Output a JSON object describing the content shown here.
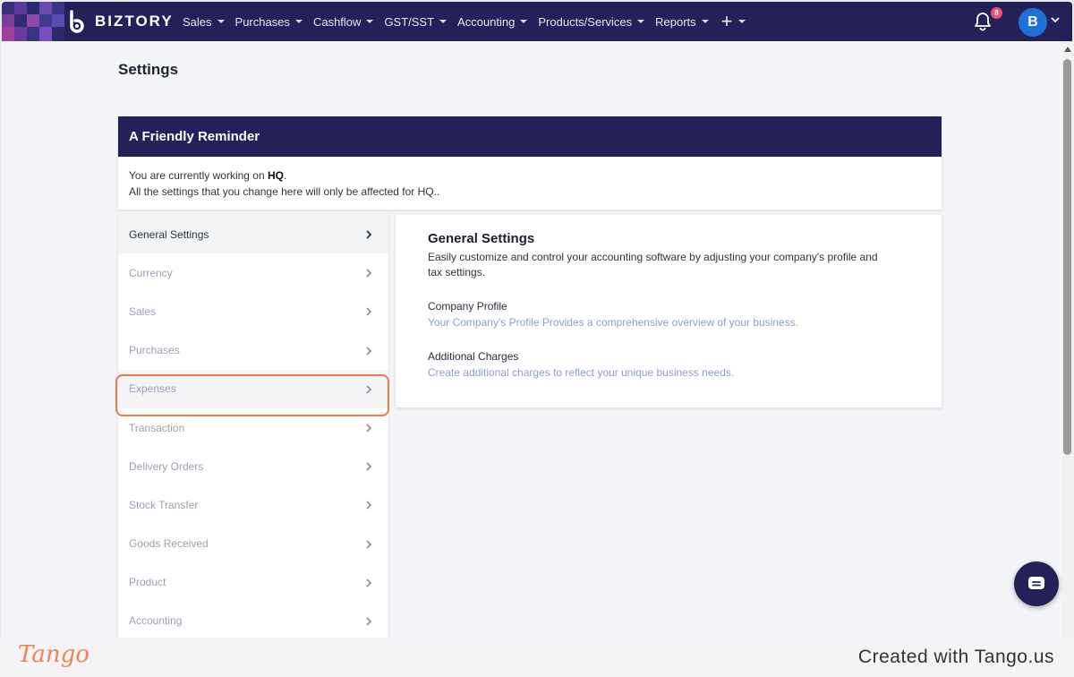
{
  "app": {
    "name": "BIZTORY"
  },
  "nav": {
    "items": [
      {
        "label": "Sales"
      },
      {
        "label": "Purchases"
      },
      {
        "label": "Cashflow"
      },
      {
        "label": "GST/SST"
      },
      {
        "label": "Accounting"
      },
      {
        "label": "Products/Services"
      },
      {
        "label": "Reports"
      }
    ],
    "plus_icon": "plus-icon",
    "notification_count": "8",
    "avatar_initial": "B"
  },
  "page": {
    "title": "Settings"
  },
  "reminder": {
    "title": "A Friendly Reminder",
    "line1_prefix": "You are currently working on ",
    "branch": "HQ",
    "line1_suffix": ".",
    "line2": "All the settings that you change here will only be affected for HQ.."
  },
  "menu": {
    "items": [
      {
        "label": "General Settings"
      },
      {
        "label": "Currency"
      },
      {
        "label": "Sales"
      },
      {
        "label": "Purchases"
      },
      {
        "label": "Expenses"
      },
      {
        "label": "Transaction"
      },
      {
        "label": "Delivery Orders"
      },
      {
        "label": "Stock Transfer"
      },
      {
        "label": "Goods Received"
      },
      {
        "label": "Product"
      },
      {
        "label": "Accounting"
      }
    ],
    "active": "General Settings",
    "highlighted": "Expenses"
  },
  "panel": {
    "title": "General Settings",
    "description": "Easily customize and control your accounting software by adjusting your company's profile and tax settings.",
    "links": [
      {
        "title": "Company Profile",
        "subtitle": "Your Company's Profile Provides a comprehensive overview of your business."
      },
      {
        "title": "Additional Charges",
        "subtitle": "Create additional charges to reflect your unique business needs."
      }
    ]
  },
  "footer": {
    "brand": "Tango",
    "text": "Created with Tango.us"
  },
  "colors": {
    "nav_bg": "#232158",
    "highlight": "#f07a45",
    "badge": "#f0506e",
    "avatar": "#1e6fd9"
  }
}
